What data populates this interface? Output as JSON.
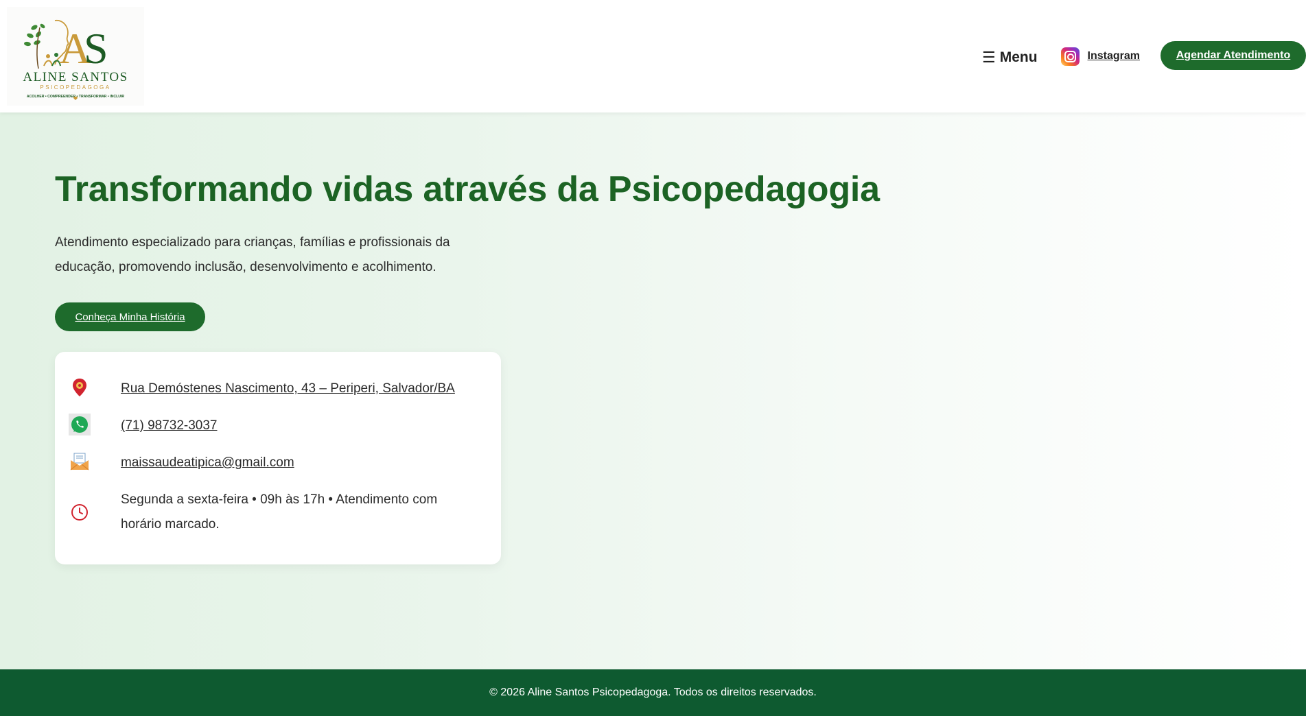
{
  "header": {
    "logo": {
      "monogram": "AS",
      "name": "ALINE SANTOS",
      "subtitle": "PSICOPEDAGOGA",
      "tagline": "ACOLHER • COMPREENDER • TRANSFORMAR • INCLUIR"
    },
    "menu_label": "Menu",
    "instagram_label": "Instagram",
    "cta_label": "Agendar Atendimento"
  },
  "hero": {
    "title": "Transformando vidas através da Psicopedagogia",
    "subtitle": "Atendimento especializado para crianças, famílias e profissionais da educação, promovendo inclusão, desenvolvimento e acolhimento.",
    "button_label": "Conheça Minha História"
  },
  "contact": {
    "address": "Rua Demóstenes Nascimento, 43 – Periperi, Salvador/BA",
    "phone": "(71) 98732-3037",
    "email": "maissaudeatipica@gmail.com",
    "hours": "Segunda a sexta-feira • 09h às 17h • Atendimento com horário marcado."
  },
  "icons": {
    "menu": "menu-icon",
    "instagram": "instagram-icon",
    "address": "location-pin-icon",
    "phone": "whatsapp-icon",
    "email": "email-envelope-icon",
    "hours": "clock-icon"
  },
  "colors": {
    "brand_green": "#1c6324",
    "button_green": "#1e6b2c",
    "footer_green": "#0e5a30",
    "gold": "#c99a3a"
  },
  "footer": {
    "copyright": "© 2026 Aline Santos Psicopedagoga. Todos os direitos reservados."
  }
}
